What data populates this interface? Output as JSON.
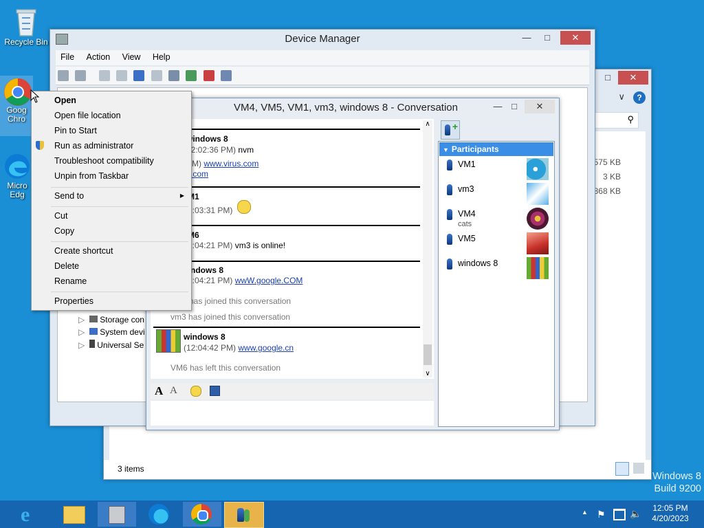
{
  "desktop": {
    "icons": [
      {
        "label": "Recycle Bin"
      },
      {
        "label": "Goog Chro"
      },
      {
        "label": "Micro Edg"
      }
    ],
    "watermark": {
      "line1": "Windows 8",
      "line2": "Build 9200"
    }
  },
  "explorer": {
    "sizes": [
      "575 KB",
      "3 KB",
      "868 KB"
    ],
    "status": "3 items"
  },
  "device_manager": {
    "title": "Device Manager",
    "menu": [
      "File",
      "Action",
      "View",
      "Help"
    ],
    "tree": [
      "Storage con",
      "System devi",
      "Universal Se"
    ]
  },
  "context_menu": {
    "items": [
      "Open",
      "Open file location",
      "Pin to Start",
      "Run as administrator",
      "Troubleshoot compatibility",
      "Unpin from Taskbar",
      "Send to",
      "Cut",
      "Copy",
      "Create shortcut",
      "Delete",
      "Rename",
      "Properties"
    ]
  },
  "conversation": {
    "title": "VM4, VM5, VM1, vm3, windows 8 - Conversation",
    "messages": [
      {
        "sender": "windows 8",
        "time": "12:02:36 PM)",
        "extra": "nvm",
        "link1": "www.virus.com",
        "link2": "s.com",
        "prefix": "PM)"
      },
      {
        "sender": "M1",
        "time": "2:03:31 PM)"
      },
      {
        "sender": "M6",
        "time": "2:04:21 PM)",
        "text": "vm3 is online!"
      },
      {
        "sender": "vindows 8",
        "time": "2:04:21 PM)",
        "link": "wwW.google.COM"
      },
      {
        "notice1": "has joined this conversation",
        "notice2": "vm3 has joined this conversation"
      },
      {
        "sender": "windows 8",
        "time": "(12:04:42 PM)",
        "link": "www.google.cn"
      },
      {
        "notice": "VM6 has left this conversation"
      }
    ],
    "participants_header": "Participants",
    "participants": [
      {
        "name": "VM1",
        "sub": ""
      },
      {
        "name": "vm3",
        "sub": ""
      },
      {
        "name": "VM4",
        "sub": "cats"
      },
      {
        "name": "VM5",
        "sub": ""
      },
      {
        "name": "windows 8",
        "sub": ""
      }
    ]
  },
  "tray": {
    "time": "12:05 PM",
    "date": "4/20/2023"
  },
  "colors": {
    "accent": "#1a8fd6",
    "taskbar": "#1565b0",
    "selected": "#3a8ee6"
  }
}
